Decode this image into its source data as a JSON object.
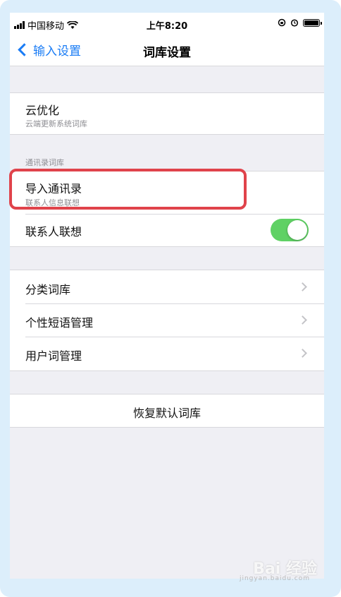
{
  "status_bar": {
    "carrier": "中国移动",
    "time": "上午8:20",
    "icons": [
      "signal-icon",
      "wifi-icon",
      "rotation-lock-icon",
      "alarm-icon",
      "battery-icon"
    ]
  },
  "nav": {
    "back_label": "输入设置",
    "title": "词库设置"
  },
  "cloud": {
    "title": "云优化",
    "subtitle": "云端更新系统词库"
  },
  "contacts_section": {
    "header": "通讯录词库",
    "import_title": "导入通讯录",
    "import_subtitle": "联系人信息联想",
    "association_label": "联系人联想",
    "association_enabled": true
  },
  "lexicon": {
    "items": [
      {
        "label": "分类词库"
      },
      {
        "label": "个性短语管理"
      },
      {
        "label": "用户词管理"
      }
    ]
  },
  "reset": {
    "label": "恢复默认词库"
  },
  "watermark": {
    "brand": "Bai 经验",
    "url": "jingyan.baidu.com"
  },
  "colors": {
    "accent": "#1a7cf5",
    "toggle_on": "#5fd164",
    "highlight": "#e0434b"
  }
}
